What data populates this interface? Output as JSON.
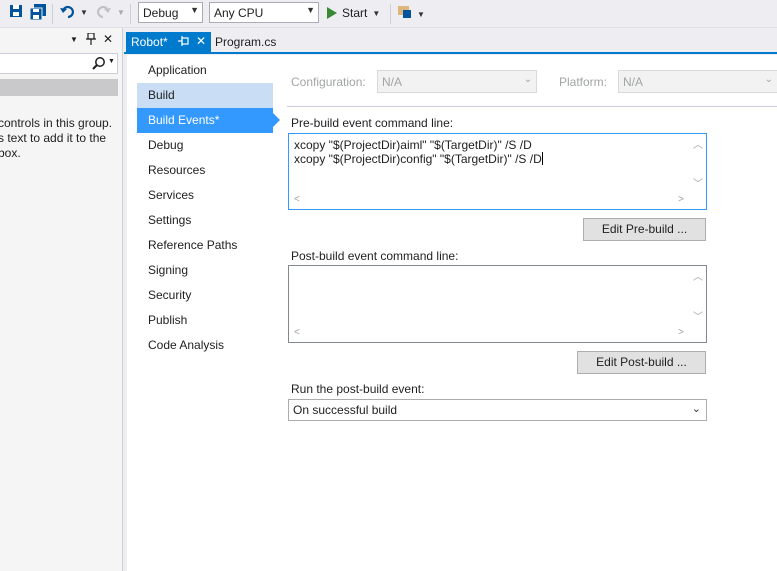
{
  "toolbar": {
    "config": "Debug",
    "platform": "Any CPU",
    "start_label": "Start"
  },
  "left_pane": {
    "message_lines": [
      "controls in this group.",
      "s text to add it to the",
      "box."
    ]
  },
  "tabs": [
    {
      "label": "Robot*",
      "active": true
    },
    {
      "label": "Program.cs",
      "active": false
    }
  ],
  "nav": {
    "items": [
      {
        "label": "Application"
      },
      {
        "label": "Build"
      },
      {
        "label": "Build Events*"
      },
      {
        "label": "Debug"
      },
      {
        "label": "Resources"
      },
      {
        "label": "Services"
      },
      {
        "label": "Settings"
      },
      {
        "label": "Reference Paths"
      },
      {
        "label": "Signing"
      },
      {
        "label": "Security"
      },
      {
        "label": "Publish"
      },
      {
        "label": "Code Analysis"
      }
    ]
  },
  "config_row": {
    "configuration_label": "Configuration:",
    "configuration_value": "N/A",
    "platform_label": "Platform:",
    "platform_value": "N/A"
  },
  "pre_build": {
    "label": "Pre-build event command line:",
    "line1": "xcopy \"$(ProjectDir)aiml\" \"$(TargetDir)\" /S /D",
    "line2": "xcopy \"$(ProjectDir)config\" \"$(TargetDir)\" /S /D",
    "button": "Edit Pre-build ..."
  },
  "post_build": {
    "label": "Post-build event command line:",
    "value": "",
    "button": "Edit Post-build ..."
  },
  "run_event": {
    "label": "Run the post-build event:",
    "value": "On successful build"
  }
}
